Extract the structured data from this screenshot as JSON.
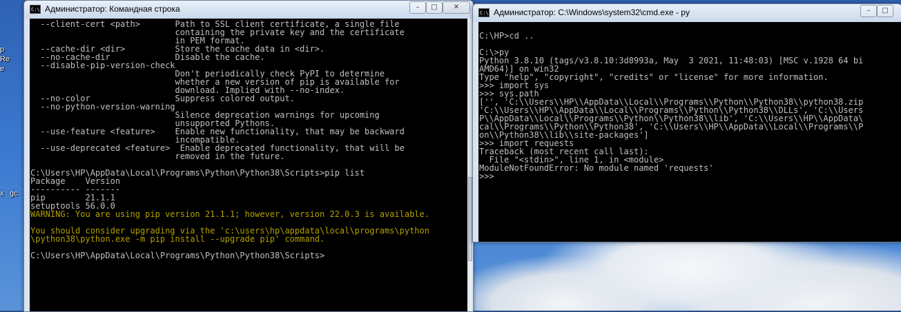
{
  "desktop": {
    "icon_labels": [
      "р",
      "Re",
      "e",
      "x",
      "gc"
    ]
  },
  "left_window": {
    "title": "Администратор: Командная строка",
    "icon_text": "C:\\",
    "controls": {
      "minimize": "–",
      "maximize": "□",
      "close": "✕"
    },
    "lines": [
      {
        "text": "  --client-cert <path>       Path to SSL client certificate, a single file",
        "type": "normal"
      },
      {
        "text": "                             containing the private key and the certificate",
        "type": "normal"
      },
      {
        "text": "                             in PEM format.",
        "type": "normal"
      },
      {
        "text": "  --cache-dir <dir>          Store the cache data in <dir>.",
        "type": "normal"
      },
      {
        "text": "  --no-cache-dir             Disable the cache.",
        "type": "normal"
      },
      {
        "text": "  --disable-pip-version-check",
        "type": "normal"
      },
      {
        "text": "                             Don't periodically check PyPI to determine",
        "type": "normal"
      },
      {
        "text": "                             whether a new version of pip is available for",
        "type": "normal"
      },
      {
        "text": "                             download. Implied with --no-index.",
        "type": "normal"
      },
      {
        "text": "  --no-color                 Suppress colored output.",
        "type": "normal"
      },
      {
        "text": "  --no-python-version-warning",
        "type": "normal"
      },
      {
        "text": "                             Silence deprecation warnings for upcoming",
        "type": "normal"
      },
      {
        "text": "                             unsupported Pythons.",
        "type": "normal"
      },
      {
        "text": "  --use-feature <feature>    Enable new functionality, that may be backward",
        "type": "normal"
      },
      {
        "text": "                             incompatible.",
        "type": "normal"
      },
      {
        "text": "  --use-deprecated <feature>  Enable deprecated functionality, that will be",
        "type": "normal"
      },
      {
        "text": "                             removed in the future.",
        "type": "normal"
      },
      {
        "text": "",
        "type": "normal"
      },
      {
        "text": "C:\\Users\\HP\\AppData\\Local\\Programs\\Python\\Python38\\Scripts>pip list",
        "type": "normal"
      },
      {
        "text": "Package    Version",
        "type": "normal"
      },
      {
        "text": "---------- -------",
        "type": "normal"
      },
      {
        "text": "pip        21.1.1",
        "type": "normal"
      },
      {
        "text": "setuptools 56.0.0",
        "type": "normal"
      },
      {
        "text": "WARNING: You are using pip version 21.1.1; however, version 22.0.3 is available.",
        "type": "warn"
      },
      {
        "text": "",
        "type": "normal"
      },
      {
        "text": "You should consider upgrading via the 'c:\\users\\hp\\appdata\\local\\programs\\python",
        "type": "warn"
      },
      {
        "text": "\\python38\\python.exe -m pip install --upgrade pip' command.",
        "type": "warn"
      },
      {
        "text": "",
        "type": "normal"
      },
      {
        "text": "C:\\Users\\HP\\AppData\\Local\\Programs\\Python\\Python38\\Scripts>",
        "type": "normal"
      }
    ]
  },
  "right_window": {
    "title": "Администратор: C:\\Windows\\system32\\cmd.exe - py",
    "icon_text": "C:\\",
    "controls": {
      "minimize": "–",
      "maximize": "□",
      "close": "✕"
    },
    "lines": [
      {
        "text": "",
        "type": "normal"
      },
      {
        "text": "C:\\HP>cd ..",
        "type": "normal"
      },
      {
        "text": "",
        "type": "normal"
      },
      {
        "text": "C:\\>py",
        "type": "normal"
      },
      {
        "text": "Python 3.8.10 (tags/v3.8.10:3d8993a, May  3 2021, 11:48:03) [MSC v.1928 64 bi",
        "type": "normal"
      },
      {
        "text": "AMD64)] on win32",
        "type": "normal"
      },
      {
        "text": "Type \"help\", \"copyright\", \"credits\" or \"license\" for more information.",
        "type": "normal"
      },
      {
        "text": ">>> import sys",
        "type": "normal"
      },
      {
        "text": ">>> sys.path",
        "type": "normal"
      },
      {
        "text": "['', 'C:\\\\Users\\\\HP\\\\AppData\\\\Local\\\\Programs\\\\Python\\\\Python38\\\\python38.zip",
        "type": "normal"
      },
      {
        "text": "'C:\\\\Users\\\\HP\\\\AppData\\\\Local\\\\Programs\\\\Python\\\\Python38\\\\DLLs', 'C:\\\\Users",
        "type": "normal"
      },
      {
        "text": "P\\\\AppData\\\\Local\\\\Programs\\\\Python\\\\Python38\\\\lib', 'C:\\\\Users\\\\HP\\\\AppData\\",
        "type": "normal"
      },
      {
        "text": "cal\\\\Programs\\\\Python\\\\Python38', 'C:\\\\Users\\\\HP\\\\AppData\\\\Local\\\\Programs\\\\P",
        "type": "normal"
      },
      {
        "text": "on\\\\Python38\\\\lib\\\\site-packages']",
        "type": "normal"
      },
      {
        "text": ">>> import requests",
        "type": "normal"
      },
      {
        "text": "Traceback (most recent call last):",
        "type": "normal"
      },
      {
        "text": "  File \"<stdin>\", line 1, in <module>",
        "type": "normal"
      },
      {
        "text": "ModuleNotFoundError: No module named 'requests'",
        "type": "normal"
      },
      {
        "text": ">>>",
        "type": "normal"
      }
    ]
  }
}
